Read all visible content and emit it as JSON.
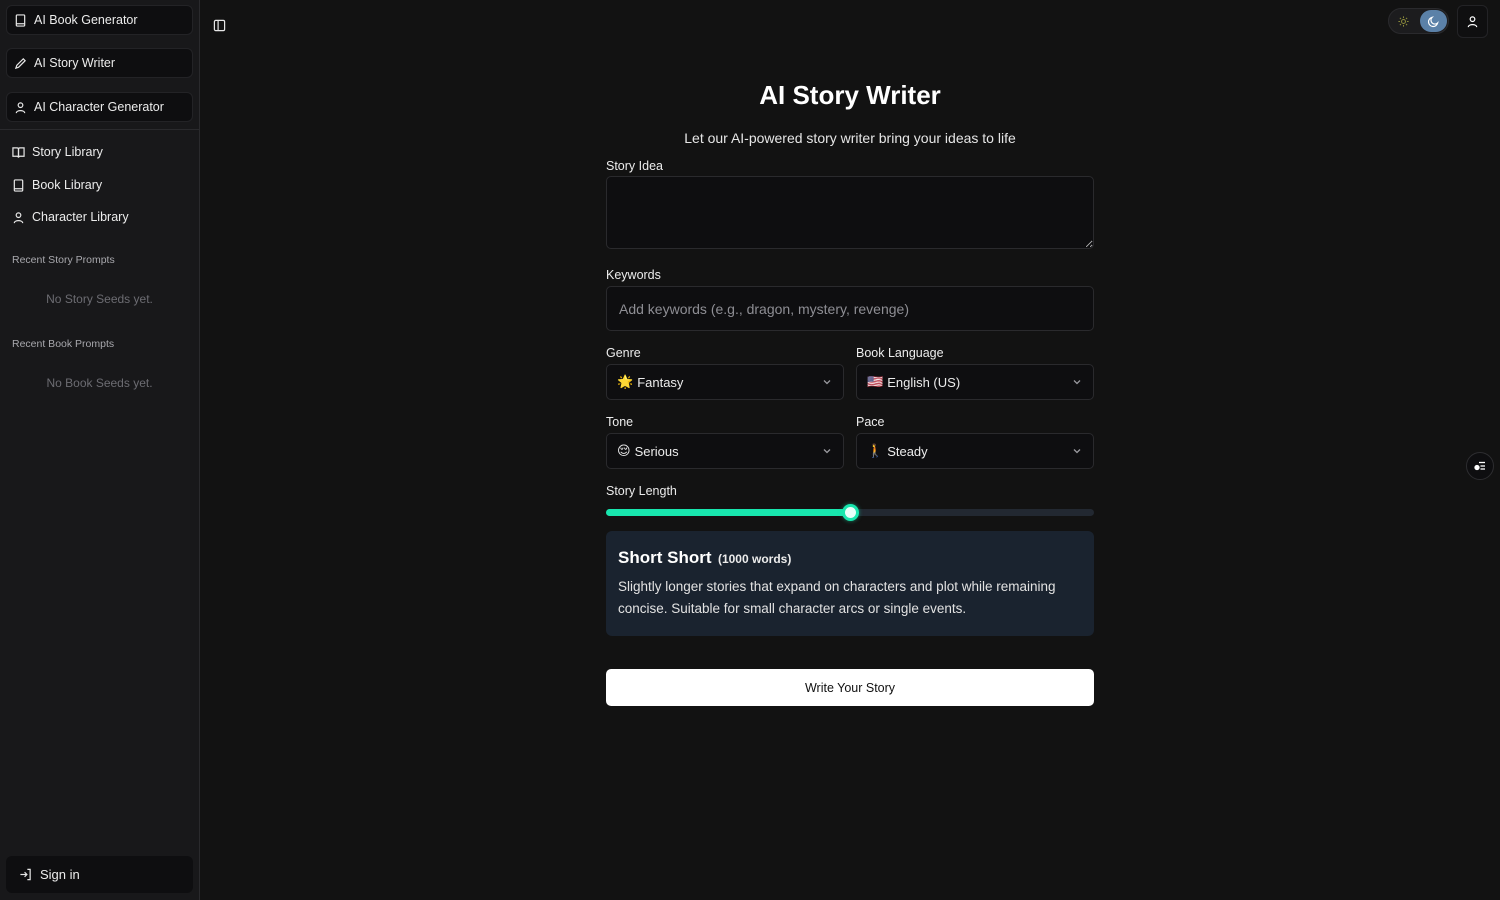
{
  "sidebar": {
    "generators": [
      {
        "label": "AI Book Generator",
        "icon": "book-icon"
      },
      {
        "label": "AI Story Writer",
        "icon": "pencil-icon"
      },
      {
        "label": "AI Character Generator",
        "icon": "user-icon"
      }
    ],
    "libraries": [
      {
        "label": "Story Library",
        "icon": "open-book-icon"
      },
      {
        "label": "Book Library",
        "icon": "book-icon"
      },
      {
        "label": "Character Library",
        "icon": "user-icon"
      }
    ],
    "recent_story": {
      "heading": "Recent Story Prompts",
      "empty": "No Story Seeds yet."
    },
    "recent_book": {
      "heading": "Recent Book Prompts",
      "empty": "No Book Seeds yet."
    },
    "sign_in": "Sign in"
  },
  "header": {
    "theme": "dark"
  },
  "main": {
    "title": "AI Story Writer",
    "subtitle": "Let our AI-powered story writer bring your ideas to life",
    "story_idea": {
      "label": "Story Idea",
      "value": ""
    },
    "keywords": {
      "label": "Keywords",
      "placeholder": "Add keywords (e.g., dragon, mystery, revenge)",
      "value": ""
    },
    "genre": {
      "label": "Genre",
      "emoji": "🌟",
      "value": "Fantasy"
    },
    "language": {
      "label": "Book Language",
      "emoji": "🇺🇸",
      "value": "English (US)"
    },
    "tone": {
      "label": "Tone",
      "emoji": "😌",
      "value": "Serious"
    },
    "pace": {
      "label": "Pace",
      "emoji": "🚶",
      "value": "Steady"
    },
    "story_length": {
      "label": "Story Length",
      "fraction": 0.5,
      "name": "Short Short",
      "words": "(1000 words)",
      "description": "Slightly longer stories that expand on characters and plot while remaining concise. Suitable for small character arcs or single events."
    },
    "submit_label": "Write Your Story"
  },
  "colors": {
    "accent": "#18e6ae",
    "background": "#121212",
    "sidebar": "#18181a",
    "card": "#1a232f",
    "toggle_knob": "#5b81a8"
  }
}
